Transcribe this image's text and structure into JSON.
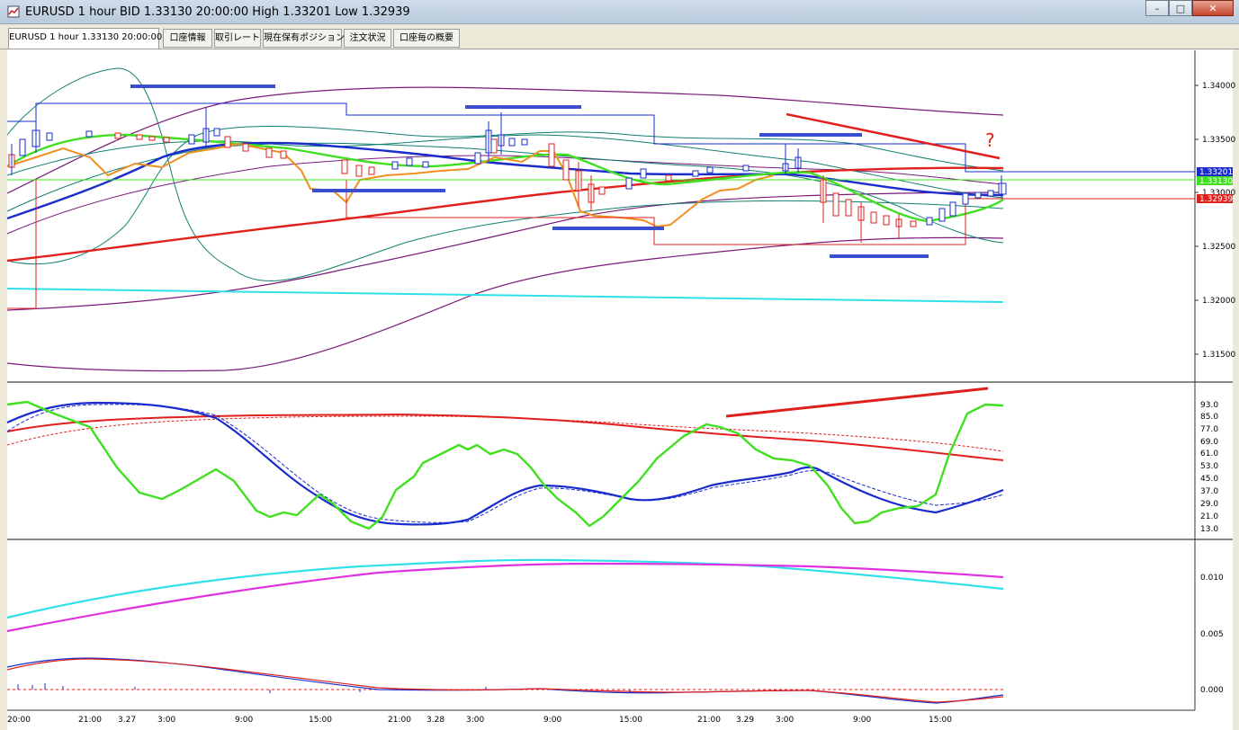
{
  "window": {
    "title": "EURUSD 1 hour BID 1.33130 20:00:00 High 1.33201 Low 1.32939",
    "buttons": [
      "–",
      "□",
      "✕"
    ]
  },
  "tabs": [
    {
      "label": "EURUSD 1 hour 1.33130 20:00:00",
      "active": true
    },
    {
      "label": "口座情報",
      "active": false
    },
    {
      "label": "取引レート",
      "active": false
    },
    {
      "label": "現在保有ポジション",
      "active": false
    },
    {
      "label": "注文状況",
      "active": false
    },
    {
      "label": "口座毎の概要",
      "active": false
    }
  ],
  "price_axis": {
    "ticks": [
      "1.34000",
      "1.33500",
      "1.33000",
      "1.32500",
      "1.32000",
      "1.31500"
    ],
    "high_tag": "1.33201",
    "close_tag": "1.33130",
    "low_tag": "1.32939"
  },
  "oscillator_axis": {
    "ticks": [
      "93.0",
      "85.0",
      "77.0",
      "69.0",
      "61.0",
      "53.0",
      "45.0",
      "37.0",
      "29.0",
      "21.0",
      "13.0"
    ]
  },
  "lower_axis": {
    "ticks": [
      "0.010",
      "0.005",
      "0.000"
    ]
  },
  "time_axis": {
    "labels": [
      "20:00",
      "21:00",
      "3.27",
      "3:00",
      "9:00",
      "15:00",
      "21:00",
      "3.28",
      "3:00",
      "9:00",
      "15:00",
      "21:00",
      "3.29",
      "3:00",
      "9:00",
      "15:00"
    ]
  },
  "annotation": {
    "text": "?"
  },
  "colors": {
    "ma_red": "#e0201c",
    "ma_blue": "#1a2ccc",
    "ma_green": "#40e020",
    "ma_orange": "#f09020",
    "cyan": "#30e0e8",
    "magenta": "#e030e0",
    "bollinger_purple": "#7a1a7a",
    "envelope_teal": "#108070"
  }
}
